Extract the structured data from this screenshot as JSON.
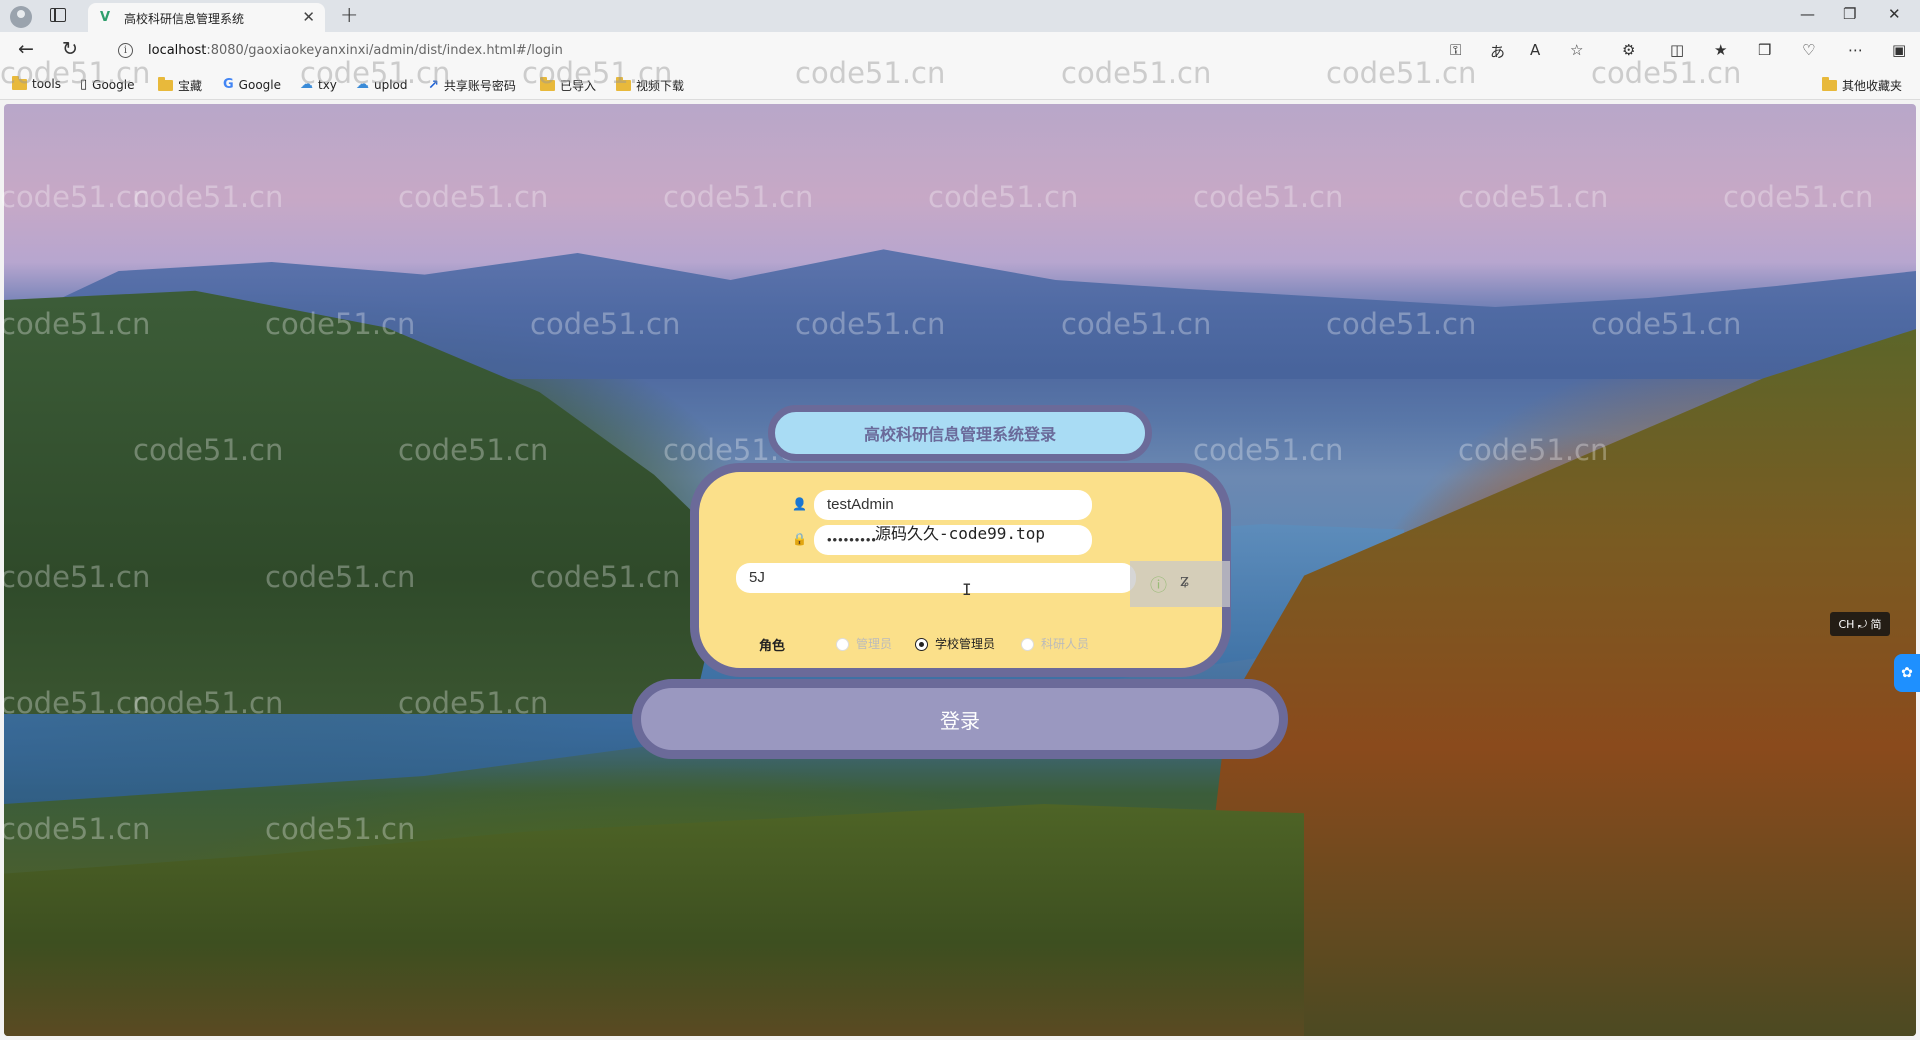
{
  "browser": {
    "tab_title": "高校科研信息管理系统",
    "url_host": "localhost",
    "url_rest": ":8080/gaoxiaokeyanxinxi/admin/dist/index.html#/login",
    "bookmarks": [
      {
        "icon": "folder-icon",
        "label": "tools"
      },
      {
        "icon": "page-icon",
        "label": "Google"
      },
      {
        "icon": "folder-icon",
        "label": "宝藏"
      },
      {
        "icon": "google-icon",
        "label": "Google"
      },
      {
        "icon": "cloud-icon",
        "label": "txy"
      },
      {
        "icon": "cloud-icon",
        "label": "uplod"
      },
      {
        "icon": "share-icon",
        "label": "共享账号密码"
      },
      {
        "icon": "folder-icon",
        "label": "已导入"
      },
      {
        "icon": "folder-icon",
        "label": "视频下载"
      }
    ],
    "other_bookmarks": "其他收藏夹"
  },
  "watermark": "code51.cn",
  "login": {
    "title": "高校科研信息管理系统登录",
    "username_value": "testAdmin",
    "password_value": "•••••••••",
    "overlay_text": "源码久久-code99.top",
    "captcha_value": "5J",
    "role_label": "角色",
    "roles": [
      {
        "label": "管理员",
        "selected": false
      },
      {
        "label": "学校管理员",
        "selected": true
      },
      {
        "label": "科研人员",
        "selected": false
      }
    ],
    "submit_label": "登录"
  },
  "ime_indicator": "CH ⤾ 简",
  "colors": {
    "card_fill": "#fbe08a",
    "border": "#6b6a99",
    "title_fill": "#a9dcf4",
    "button_fill": "#9a98c0"
  }
}
